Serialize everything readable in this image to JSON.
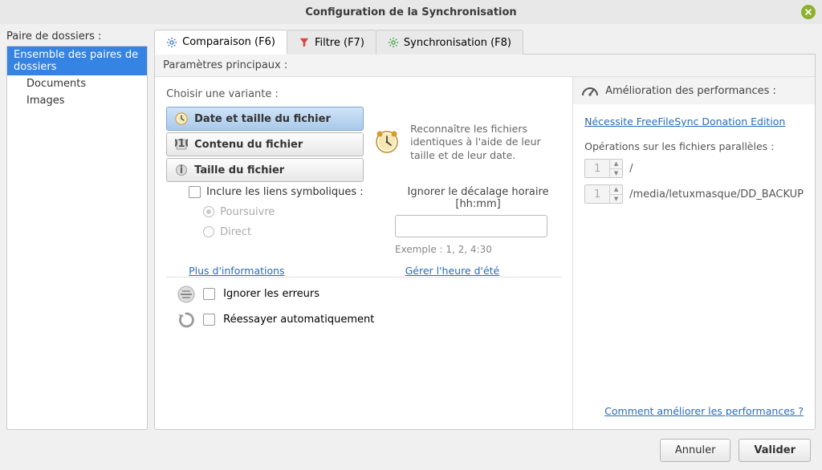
{
  "title": "Configuration de la Synchronisation",
  "sidebar": {
    "label": "Paire de dossiers :",
    "items": [
      {
        "label": "Ensemble des paires de dossiers",
        "selected": true
      },
      {
        "label": "Documents"
      },
      {
        "label": "Images"
      }
    ]
  },
  "tabs": [
    {
      "label": "Comparaison (F6)"
    },
    {
      "label": "Filtre (F7)"
    },
    {
      "label": "Synchronisation (F8)"
    }
  ],
  "main_params_label": "Paramètres principaux :",
  "choose_variant_label": "Choisir une variante :",
  "variants": [
    {
      "label": "Date et taille du fichier"
    },
    {
      "label": "Contenu du fichier"
    },
    {
      "label": "Taille du fichier"
    }
  ],
  "variant_desc": "Reconnaître les fichiers identiques à l'aide de leur taille et de leur date.",
  "symlinks_label": "Inclure les liens symboliques :",
  "symlink_follow": "Poursuivre",
  "symlink_direct": "Direct",
  "more_info_link": "Plus d'informations",
  "tz_label": "Ignorer le décalage horaire [hh:mm]",
  "tz_example": "Exemple :  1, 2, 4:30",
  "dst_link": "Gérer l'heure d'été",
  "ignore_errors_label": "Ignorer les erreurs",
  "retry_label": "Réessayer automatiquement",
  "perf": {
    "header": "Amélioration des performances :",
    "requires_link": "Nécessite FreeFileSync Donation Edition",
    "parallel_label": "Opérations sur les fichiers parallèles :",
    "rows": [
      {
        "value": "1",
        "path": "/"
      },
      {
        "value": "1",
        "path": "/media/letuxmasque/DD_BACKUP"
      }
    ],
    "howto_link": "Comment améliorer les performances ?"
  },
  "cancel_label": "Annuler",
  "ok_label": "Valider"
}
